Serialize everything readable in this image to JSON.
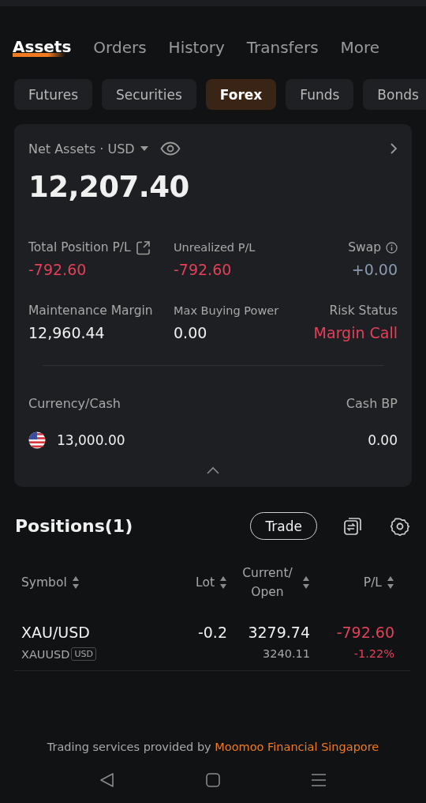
{
  "tabs": [
    {
      "label": "Assets",
      "selected": true
    },
    {
      "label": "Orders",
      "selected": false
    },
    {
      "label": "History",
      "selected": false
    },
    {
      "label": "Transfers",
      "selected": false
    },
    {
      "label": "More",
      "selected": false
    }
  ],
  "chips": [
    {
      "label": "Futures",
      "selected": false
    },
    {
      "label": "Securities",
      "selected": false
    },
    {
      "label": "Forex",
      "selected": true
    },
    {
      "label": "Funds",
      "selected": false
    },
    {
      "label": "Bonds",
      "selected": false
    }
  ],
  "summary": {
    "label": "Net Assets · USD",
    "value": "12,207.40",
    "metrics": [
      {
        "label": "Total Position P/L",
        "value": "-792.60",
        "color": "#e4405a"
      },
      {
        "label": "Unrealized P/L",
        "value": "-792.60",
        "color": "#e4405a"
      },
      {
        "label": "Swap",
        "value": "+0.00",
        "color": "#8a9ab0"
      },
      {
        "label": "Maintenance Margin",
        "value": "12,960.44",
        "color": "#f0f0f0"
      },
      {
        "label": "Max Buying Power",
        "value": "0.00",
        "color": "#f0f0f0"
      },
      {
        "label": "Risk Status",
        "value": "Margin Call",
        "color": "#e4405a"
      }
    ],
    "cash_header": [
      "Currency/Cash",
      "Cash BP"
    ],
    "cash_rows": [
      {
        "amount": "13,000.00",
        "cash_bp": "0.00"
      }
    ]
  },
  "positions": {
    "title": "Positions(1)",
    "trade_button": "Trade",
    "columns": [
      {
        "label": "Symbol",
        "kind": "single"
      },
      {
        "label": "Lot",
        "kind": "single"
      },
      {
        "label": "Current/ Open",
        "kind": "double"
      },
      {
        "label": "P/L",
        "kind": "single"
      }
    ],
    "rows": [
      {
        "symbol": "XAU/USD",
        "code": "XAUUSD",
        "currency": "USD",
        "lot": "-0.2",
        "current": "3279.74",
        "open": "3240.11",
        "pl": "-792.60",
        "pl_pct": "-1.22%",
        "color": "#e4405a"
      }
    ]
  },
  "footer": {
    "text": "Trading services provided by",
    "link": "Moomoo Financial Singapore"
  }
}
